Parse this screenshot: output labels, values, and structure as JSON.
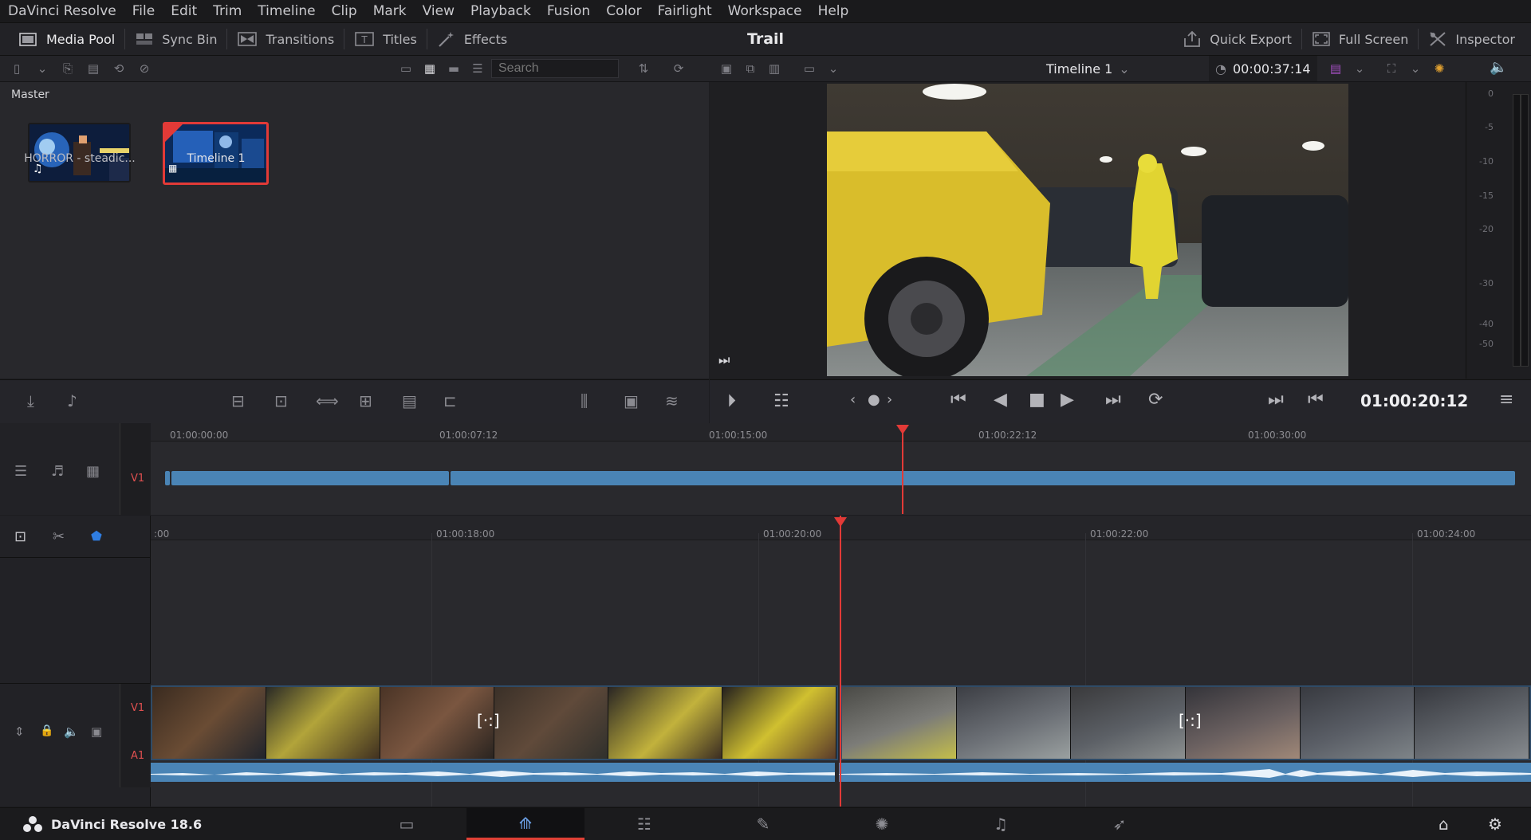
{
  "app": {
    "name": "DaVinci Resolve",
    "version_label": "DaVinci Resolve 18.6",
    "project_title": "Trail"
  },
  "menu": [
    "DaVinci Resolve",
    "File",
    "Edit",
    "Trim",
    "Timeline",
    "Clip",
    "Mark",
    "View",
    "Playback",
    "Fusion",
    "Color",
    "Fairlight",
    "Workspace",
    "Help"
  ],
  "toolbar": {
    "left": [
      {
        "label": "Media Pool",
        "icon": "media-pool-icon",
        "active": true
      },
      {
        "label": "Sync Bin",
        "icon": "sync-bin-icon",
        "active": false
      },
      {
        "label": "Transitions",
        "icon": "transitions-icon",
        "active": false
      },
      {
        "label": "Titles",
        "icon": "titles-icon",
        "active": false
      },
      {
        "label": "Effects",
        "icon": "effects-icon",
        "active": false
      }
    ],
    "right": [
      {
        "label": "Quick Export",
        "icon": "quick-export-icon"
      },
      {
        "label": "Full Screen",
        "icon": "full-screen-icon"
      },
      {
        "label": "Inspector",
        "icon": "inspector-icon"
      }
    ]
  },
  "subbar": {
    "search_placeholder": "Search",
    "timeline_name": "Timeline 1",
    "duration": "00:00:37:14"
  },
  "media_pool": {
    "bin": "Master",
    "items": [
      {
        "label": "HORROR - steadic...",
        "selected": false,
        "icon": "music-note-icon"
      },
      {
        "label": "Timeline 1",
        "selected": true,
        "icon": "timeline-icon"
      }
    ]
  },
  "meter": {
    "ticks": [
      "0",
      "-5",
      "-10",
      "-15",
      "-20",
      "-30",
      "-40",
      "-50"
    ]
  },
  "transport": {
    "timecode": "01:00:20:12"
  },
  "upper_timeline": {
    "ruler": [
      "01:00:00:00",
      "01:00:07:12",
      "01:00:15:00",
      "01:00:22:12",
      "01:00:30:00"
    ],
    "track": "V1"
  },
  "lower_timeline": {
    "ruler": [
      ":00",
      "01:00:18:00",
      "01:00:20:00",
      "01:00:22:00",
      "01:00:24:00"
    ],
    "video_track": "V1",
    "audio_track": "A1"
  },
  "pages": [
    {
      "name": "media",
      "icon": "media-page-icon"
    },
    {
      "name": "cut",
      "icon": "cut-page-icon",
      "active": true
    },
    {
      "name": "edit",
      "icon": "edit-page-icon"
    },
    {
      "name": "fusion",
      "icon": "fusion-page-icon"
    },
    {
      "name": "color",
      "icon": "color-page-icon"
    },
    {
      "name": "fairlight",
      "icon": "fairlight-page-icon"
    },
    {
      "name": "deliver",
      "icon": "deliver-page-icon"
    }
  ],
  "colors": {
    "accent": "#e23a37",
    "clip_blue": "#4a84b5",
    "playhead": "#e23a37"
  }
}
